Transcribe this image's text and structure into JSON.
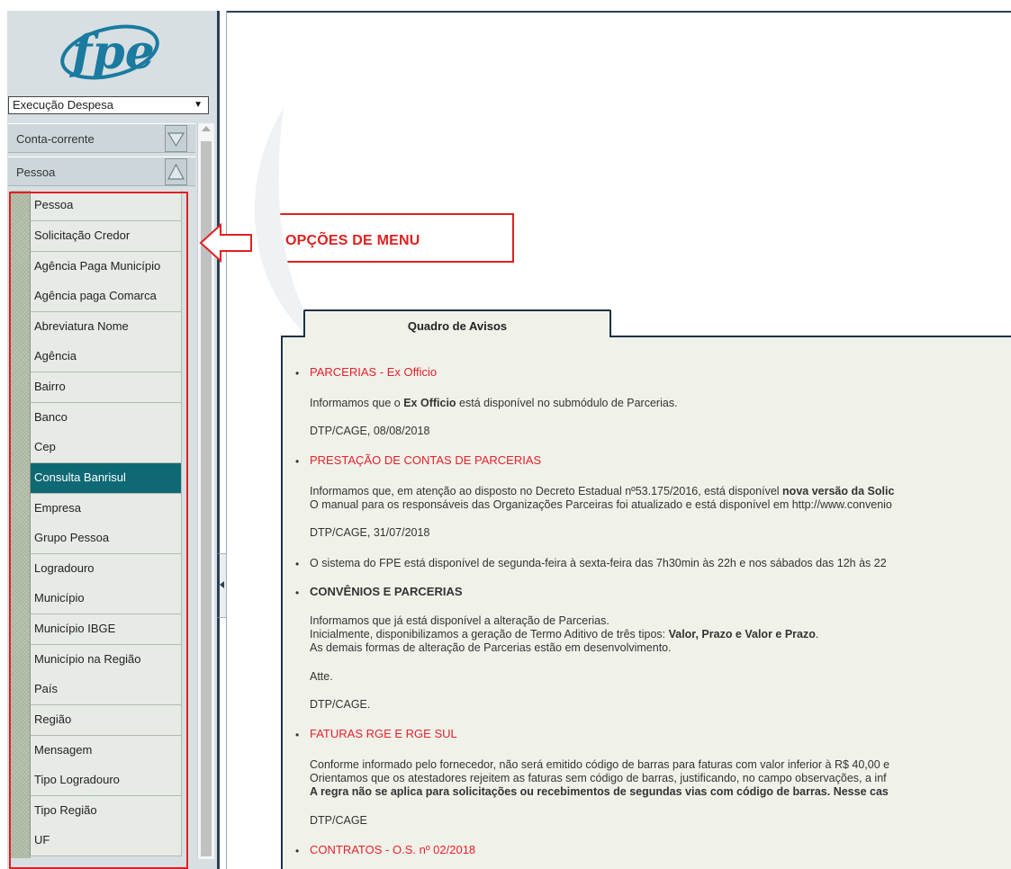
{
  "sidebar": {
    "logo_text": "fpe",
    "module_select": {
      "value": "Execução Despesa"
    },
    "sections": [
      {
        "label": "Conta-corrente",
        "expanded": false
      },
      {
        "label": "Pessoa",
        "expanded": true
      }
    ],
    "menu_items": [
      "Pessoa",
      "Solicitação Credor",
      "Agência Paga Município",
      "Agência paga Comarca",
      "Abreviatura Nome",
      "Agência",
      "Bairro",
      "Banco",
      "Cep",
      "Consulta Banrisul",
      "Empresa",
      "Grupo Pessoa",
      "Logradouro",
      "Município",
      "Município IBGE",
      "Município na Região",
      "País",
      "Região",
      "Mensagem",
      "Tipo Logradouro",
      "Tipo Região",
      "UF"
    ],
    "active_item": "Consulta Banrisul"
  },
  "annotation": {
    "callout_label": "OPÇÕES DE MENU"
  },
  "board": {
    "tab_label": "Quadro de Avisos",
    "notices": {
      "n1": {
        "title": "PARCERIAS - Ex Officio",
        "line1_a": "Informamos que o ",
        "line1_b": "Ex Officio",
        "line1_c": " está disponível no submódulo de Parcerias.",
        "sign": "DTP/CAGE, 08/08/2018"
      },
      "n2": {
        "title": "PRESTAÇÃO DE CONTAS DE PARCERIAS",
        "line1_a": "Informamos que, em atenção ao disposto no Decreto Estadual nº53.175/2016, está disponível ",
        "line1_b": "nova versão da Solic",
        "line2": "O manual para os responsáveis das Organizações Parceiras foi atualizado e está disponível em http://www.convenio",
        "sign": "DTP/CAGE, 31/07/2018"
      },
      "n3": {
        "text": "O sistema do FPE está disponível de segunda-feira à sexta-feira das 7h30min às 22h e nos sábados das 12h às 22"
      },
      "n4": {
        "title": "CONVÊNIOS E PARCERIAS",
        "line1": "Informamos que já está disponível a alteração de Parcerias.",
        "line2_a": "Inicialmente, disponibilizamos a geração de Termo Aditivo de três tipos: ",
        "line2_b": "Valor, Prazo e Valor e Prazo",
        "line2_c": ".",
        "line3": "As demais formas de alteração de Parcerias estão em desenvolvimento.",
        "atte": "Atte.",
        "sign": "DTP/CAGE."
      },
      "n5": {
        "title": "FATURAS RGE E RGE SUL",
        "line1": "Conforme informado pelo fornecedor, não será emitido código de barras para faturas com valor inferior à R$ 40,00 e",
        "line2": "Orientamos que os atestadores rejeitem as faturas sem código de barras, justificando, no campo observações, a inf",
        "line3": "A regra não se aplica para solicitações ou recebimentos de segundas vias com código de barras. Nesse cas",
        "sign": "DTP/CAGE"
      },
      "n6": {
        "title": "CONTRATOS - O.S. nº 02/2018"
      }
    }
  },
  "colors": {
    "accent_teal": "#0f6975",
    "notice_red": "#e8202a",
    "annotation_red": "#e02020",
    "frame_navy": "#1d3048",
    "logo_blue": "#1a7aa0"
  },
  "icons": [
    "chevron-down-icon",
    "chevron-up-icon",
    "collapse-left-icon",
    "dropdown-arrow-icon",
    "left-arrow-callout-icon"
  ]
}
